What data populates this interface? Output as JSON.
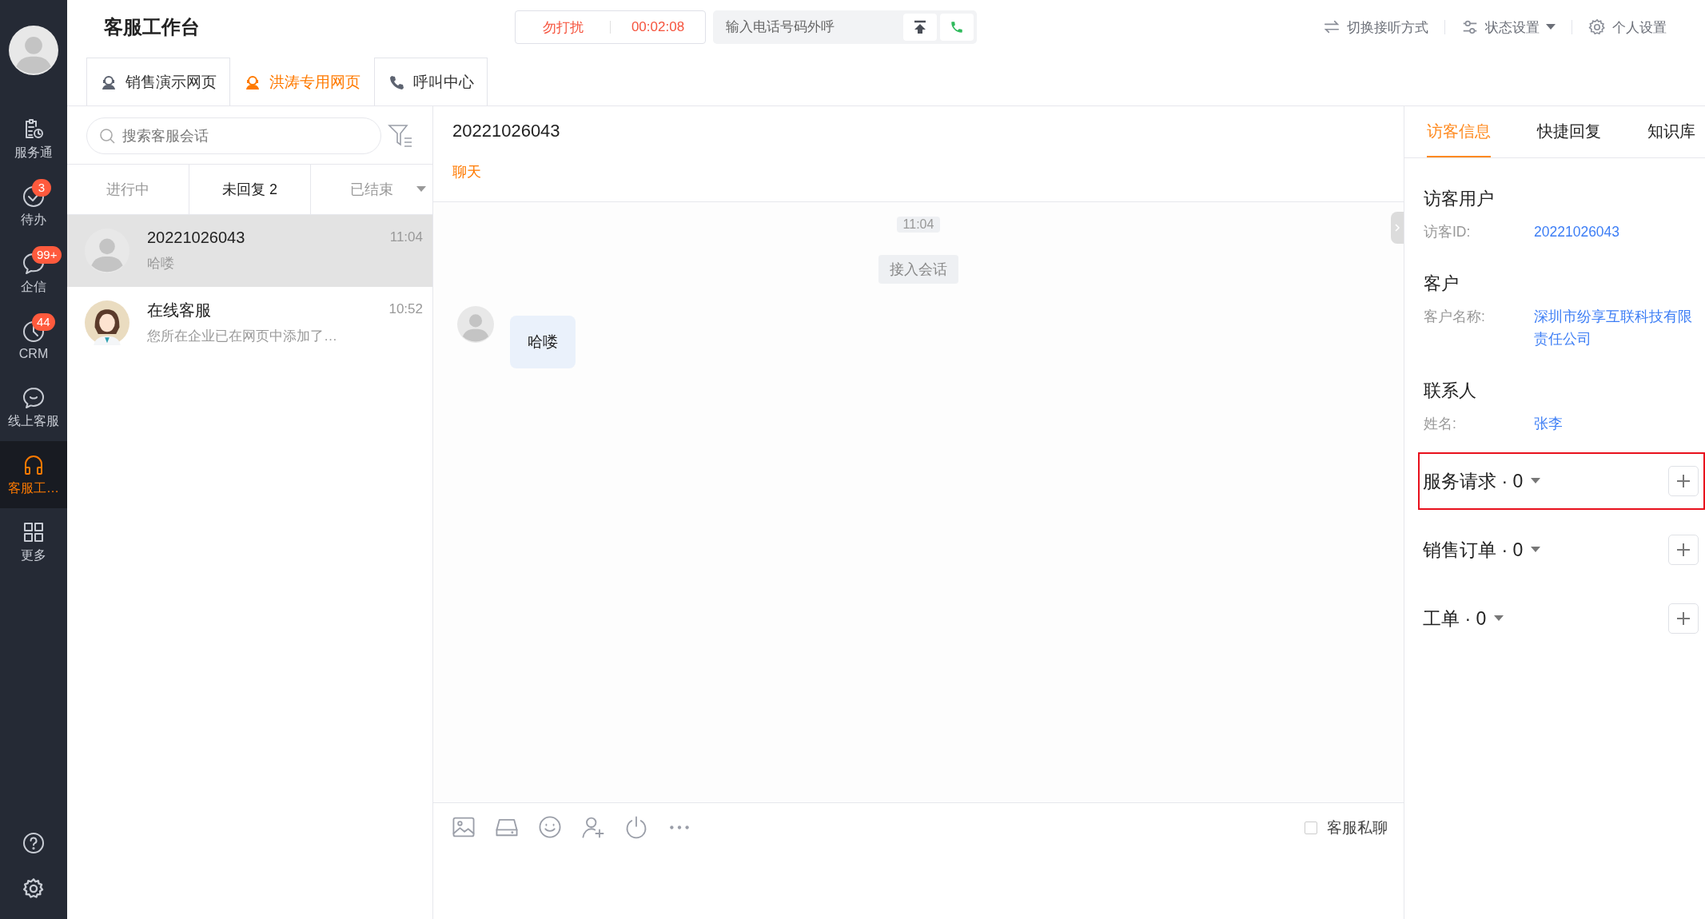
{
  "sidebar": {
    "items": [
      {
        "label": "服务通",
        "selected": false
      },
      {
        "label": "待办",
        "badge": "3",
        "selected": false
      },
      {
        "label": "企信",
        "badge": "99+",
        "selected": false
      },
      {
        "label": "CRM",
        "badge": "44",
        "selected": false
      },
      {
        "label": "线上客服",
        "selected": false
      },
      {
        "label": "客服工…",
        "selected": true
      },
      {
        "label": "更多",
        "selected": false
      }
    ]
  },
  "header": {
    "title": "客服工作台",
    "status": {
      "label": "勿打扰",
      "timer": "00:02:08"
    },
    "dial": {
      "placeholder": "输入电话号码外呼"
    },
    "actions": [
      {
        "label": "切换接听方式",
        "dropdown": false
      },
      {
        "label": "状态设置",
        "dropdown": true
      },
      {
        "label": "个人设置",
        "dropdown": false
      }
    ]
  },
  "tabs": [
    {
      "label": "销售演示网页",
      "selected": false
    },
    {
      "label": "洪涛专用网页",
      "selected": true
    },
    {
      "label": "呼叫中心",
      "selected": false
    }
  ],
  "conversations": {
    "search": {
      "placeholder": "搜索客服会话"
    },
    "filters": [
      {
        "label": "进行中",
        "selected": false,
        "dropdown": false
      },
      {
        "label": "未回复 2",
        "selected": true,
        "dropdown": false
      },
      {
        "label": "已结束",
        "selected": false,
        "dropdown": true
      }
    ],
    "items": [
      {
        "kind": "visitor",
        "name": "20221026043",
        "time": "11:04",
        "preview": "哈喽",
        "selected": true
      },
      {
        "kind": "agent",
        "name": "在线客服",
        "time": "10:52",
        "preview": "您所在企业已在网页中添加了…",
        "selected": false
      }
    ]
  },
  "chat": {
    "title": "20221026043",
    "channel": "聊天",
    "messages": [
      {
        "kind": "time",
        "text": "11:04"
      },
      {
        "kind": "system",
        "text": "接入会话"
      },
      {
        "kind": "incoming",
        "text": "哈喽"
      }
    ],
    "private_chat": {
      "label": "客服私聊",
      "checked": false
    }
  },
  "details": {
    "tabs": [
      {
        "label": "访客信息",
        "selected": true
      },
      {
        "label": "快捷回复",
        "selected": false
      },
      {
        "label": "知识库",
        "selected": false
      }
    ],
    "groups": [
      {
        "title": "访客用户",
        "fields": [
          {
            "label": "访客ID:",
            "value": "20221026043"
          }
        ]
      },
      {
        "title": "客户",
        "fields": [
          {
            "label": "客户名称:",
            "value": "深圳市纷享互联科技有限责任公司"
          }
        ]
      },
      {
        "title": "联系人",
        "fields": [
          {
            "label": "姓名:",
            "value": "张李"
          }
        ]
      }
    ],
    "records": [
      {
        "title": "服务请求 · 0",
        "highlighted": true
      },
      {
        "title": "销售订单 · 0",
        "highlighted": false
      },
      {
        "title": "工单 · 0",
        "highlighted": false
      }
    ]
  }
}
